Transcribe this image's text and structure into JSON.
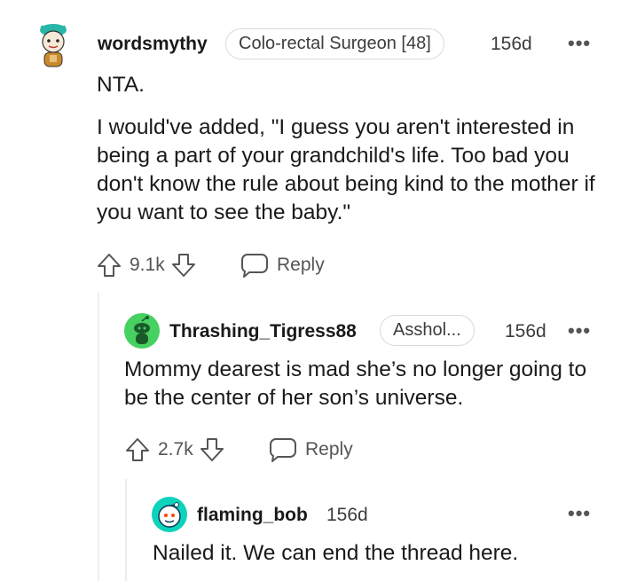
{
  "comments": [
    {
      "username": "wordsmythy",
      "flair": "Colo-rectal Surgeon [48]",
      "age": "156d",
      "more": "•••",
      "paragraphs": [
        "NTA.",
        "I would've added, \"I guess you aren't interested in being a part of your grandchild's life. Too bad you don't know the rule about being kind to the mother if you want to see the baby.\""
      ],
      "votes": "9.1k",
      "reply_label": "Reply"
    },
    {
      "username": "Thrashing_Tigress88",
      "flair": "Asshol...",
      "age": "156d",
      "more": "•••",
      "paragraphs": [
        "Mommy dearest is mad she’s no longer going to be the center of her son’s universe."
      ],
      "votes": "2.7k",
      "reply_label": "Reply"
    },
    {
      "username": "flaming_bob",
      "age": "156d",
      "more": "•••",
      "paragraphs": [
        "Nailed it. We can end the thread here."
      ]
    }
  ],
  "colors": {
    "text": "#1a1a1b",
    "muted": "#555555",
    "thread_line": "#eceef0",
    "avatar_green": "#46d160",
    "avatar_teal": "#0dd3bb"
  }
}
